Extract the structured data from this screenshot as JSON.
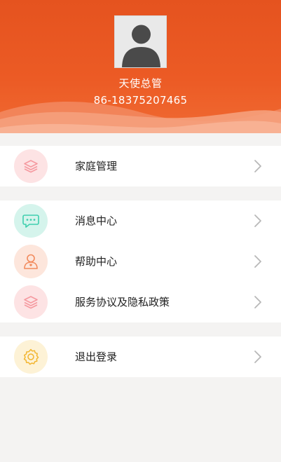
{
  "profile": {
    "name": "天使总管",
    "phone": "86-18375207465"
  },
  "menu": {
    "family": {
      "label": "家庭管理",
      "icon": "layers-icon",
      "color": "#f59aa0"
    },
    "messages": {
      "label": "消息中心",
      "icon": "chat-bubble-icon",
      "color": "#3fcfae"
    },
    "help": {
      "label": "帮助中心",
      "icon": "support-person-icon",
      "color": "#f28a5c"
    },
    "agreement": {
      "label": "服务协议及隐私政策",
      "icon": "layers-icon",
      "color": "#f59aa0"
    },
    "logout": {
      "label": "退出登录",
      "icon": "gear-icon",
      "color": "#f2b52f"
    }
  },
  "colors": {
    "header": "#ec5b25",
    "background": "#f4f3f2"
  }
}
